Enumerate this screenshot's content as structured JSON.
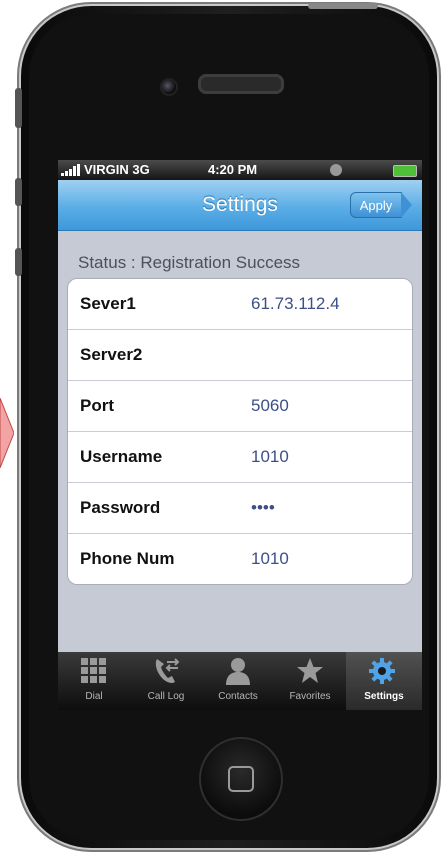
{
  "status_bar": {
    "carrier": "VIRGIN 3G",
    "time": "4:20 PM"
  },
  "nav": {
    "title": "Settings",
    "apply_label": "Apply"
  },
  "status_text": "Status : Registration Success",
  "fields": [
    {
      "label": "Sever1",
      "value": "61.73.112.4"
    },
    {
      "label": "Server2",
      "value": ""
    },
    {
      "label": "Port",
      "value": "5060"
    },
    {
      "label": "Username",
      "value": "1010"
    },
    {
      "label": "Password",
      "value": "••••"
    },
    {
      "label": "Phone Num",
      "value": "1010"
    }
  ],
  "tabs": [
    {
      "label": "Dial",
      "icon": "keypad-icon"
    },
    {
      "label": "Call Log",
      "icon": "call-log-icon"
    },
    {
      "label": "Contacts",
      "icon": "contacts-icon"
    },
    {
      "label": "Favorites",
      "icon": "star-icon"
    },
    {
      "label": "Settings",
      "icon": "gear-icon",
      "active": true
    }
  ],
  "colors": {
    "nav_blue": "#5aaee6",
    "value_text": "#3d4f86",
    "screen_bg": "#c5cad4"
  }
}
